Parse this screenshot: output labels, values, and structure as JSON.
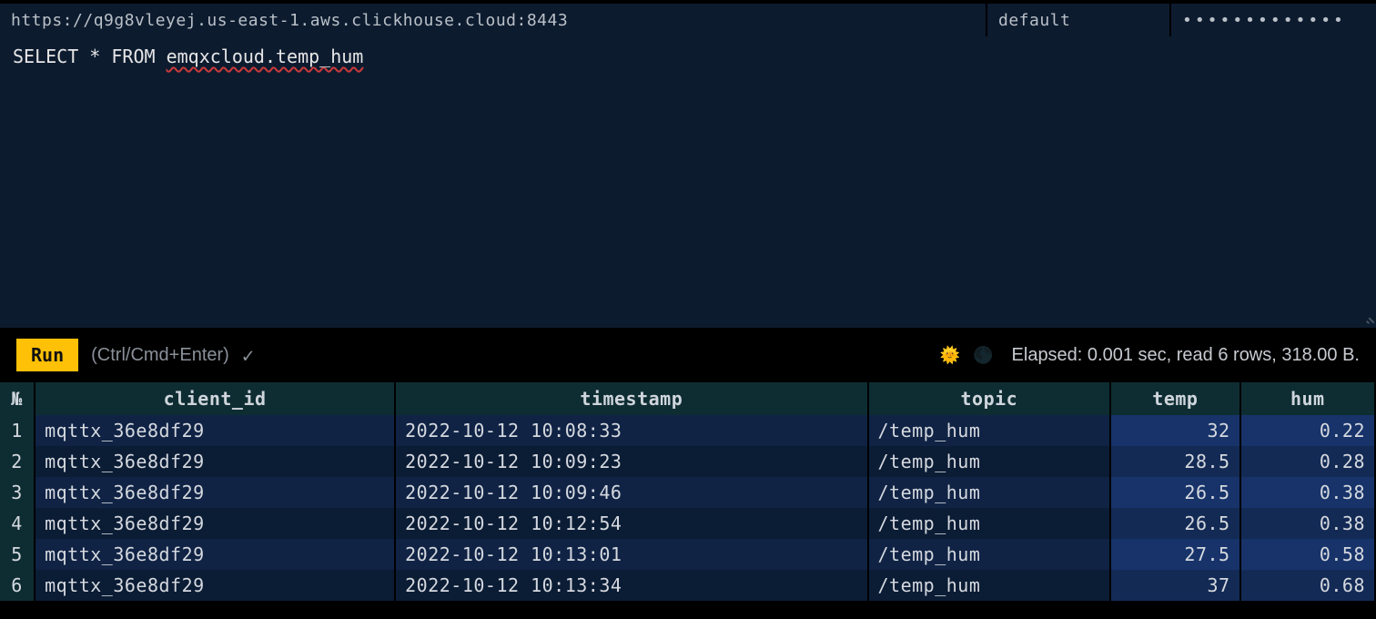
{
  "connection": {
    "url": "https://q9g8vleyej.us-east-1.aws.clickhouse.cloud:8443",
    "username": "default",
    "password_mask": "●●●●●●●●●●●●●"
  },
  "query": {
    "prefix": "SELECT * FROM ",
    "table_ref": "emqxcloud.temp_hum"
  },
  "actions": {
    "run_label": "Run",
    "hint": "(Ctrl/Cmd+Enter)",
    "check_glyph": "✓",
    "sun_glyph": "🌞",
    "moon_glyph": "🌑"
  },
  "stats": {
    "text": "Elapsed: 0.001 sec, read 6 rows, 318.00 B."
  },
  "table": {
    "rownum_header": "№",
    "columns": [
      "client_id",
      "timestamp",
      "topic",
      "temp",
      "hum"
    ],
    "rows": [
      {
        "n": "1",
        "client_id": "mqttx_36e8df29",
        "timestamp": "2022-10-12 10:08:33",
        "topic": "/temp_hum",
        "temp": "32",
        "hum": "0.22"
      },
      {
        "n": "2",
        "client_id": "mqttx_36e8df29",
        "timestamp": "2022-10-12 10:09:23",
        "topic": "/temp_hum",
        "temp": "28.5",
        "hum": "0.28"
      },
      {
        "n": "3",
        "client_id": "mqttx_36e8df29",
        "timestamp": "2022-10-12 10:09:46",
        "topic": "/temp_hum",
        "temp": "26.5",
        "hum": "0.38"
      },
      {
        "n": "4",
        "client_id": "mqttx_36e8df29",
        "timestamp": "2022-10-12 10:12:54",
        "topic": "/temp_hum",
        "temp": "26.5",
        "hum": "0.38"
      },
      {
        "n": "5",
        "client_id": "mqttx_36e8df29",
        "timestamp": "2022-10-12 10:13:01",
        "topic": "/temp_hum",
        "temp": "27.5",
        "hum": "0.58"
      },
      {
        "n": "6",
        "client_id": "mqttx_36e8df29",
        "timestamp": "2022-10-12 10:13:34",
        "topic": "/temp_hum",
        "temp": "37",
        "hum": "0.68"
      }
    ]
  }
}
